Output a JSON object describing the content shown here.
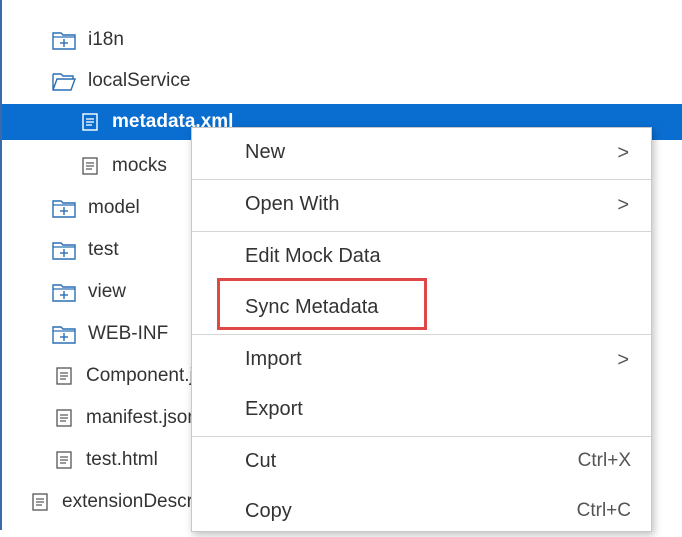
{
  "tree": {
    "items": [
      {
        "label": "i18n",
        "icon": "folder-plus-icon"
      },
      {
        "label": "localService",
        "icon": "folder-open-icon"
      },
      {
        "label": "metadata.xml",
        "icon": "document-icon",
        "selected": true
      },
      {
        "label": "mocks",
        "icon": "document-icon"
      },
      {
        "label": "model",
        "icon": "folder-plus-icon"
      },
      {
        "label": "test",
        "icon": "folder-plus-icon"
      },
      {
        "label": "view",
        "icon": "folder-plus-icon"
      },
      {
        "label": "WEB-INF",
        "icon": "folder-plus-icon"
      },
      {
        "label": "Component.js",
        "icon": "document-icon"
      },
      {
        "label": "manifest.json",
        "icon": "document-icon"
      },
      {
        "label": "test.html",
        "icon": "document-icon"
      },
      {
        "label": "extensionDescriptor",
        "icon": "document-icon"
      }
    ]
  },
  "context_menu": {
    "items": [
      {
        "label": "New",
        "submenu_indicator": ">"
      },
      {
        "label": "Open With",
        "submenu_indicator": ">"
      },
      {
        "label": "Edit Mock Data"
      },
      {
        "label": "Sync Metadata",
        "highlighted": true
      },
      {
        "label": "Import",
        "submenu_indicator": ">"
      },
      {
        "label": "Export"
      },
      {
        "label": "Cut",
        "shortcut": "Ctrl+X"
      },
      {
        "label": "Copy",
        "shortcut": "Ctrl+C"
      }
    ]
  },
  "colors": {
    "selection": "#0a6ed1",
    "icon": "#2a6fb3",
    "highlight_border": "#e04848"
  }
}
